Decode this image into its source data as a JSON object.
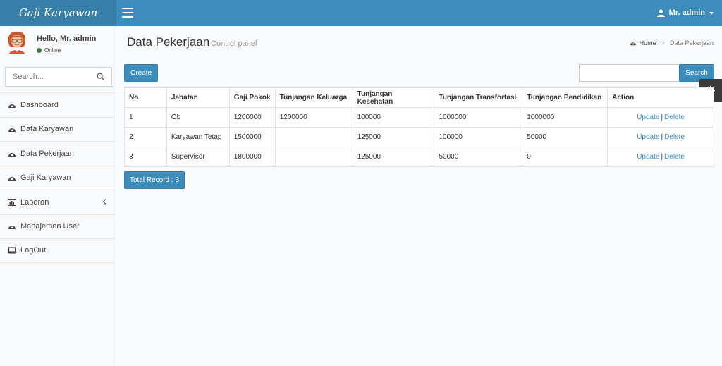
{
  "app": {
    "logo_text": "Gaji Karyawan"
  },
  "header": {
    "user_label": "Mr. admin"
  },
  "sidebar": {
    "greeting": "Hello, Mr. admin",
    "status": "Online",
    "search_placeholder": "Search...",
    "items": [
      {
        "label": "Dashboard",
        "icon": "dashboard-icon"
      },
      {
        "label": "Data Karyawan",
        "icon": "dashboard-icon"
      },
      {
        "label": "Data Pekerjaan",
        "icon": "dashboard-icon"
      },
      {
        "label": "Gaji Karyawan",
        "icon": "dashboard-icon"
      },
      {
        "label": "Laporan",
        "icon": "bar-chart-icon"
      },
      {
        "label": "Manajemen User",
        "icon": "dashboard-icon"
      },
      {
        "label": "LogOut",
        "icon": "laptop-icon"
      }
    ]
  },
  "page": {
    "title": "Data Pekerjaan",
    "subtitle": "Control panel",
    "breadcrumb": {
      "home": "Home",
      "current": "Data Pekerjaan"
    }
  },
  "toolbar": {
    "create_label": "Create",
    "search_label": "Search"
  },
  "table": {
    "headers": [
      "No",
      "Jabatan",
      "Gaji Pokok",
      "Tunjangan Keluarga",
      "Tunjangan Kesehatan",
      "Tunjangan Transfortasi",
      "Tunjangan Pendidikan",
      "Action"
    ],
    "rows": [
      {
        "no": "1",
        "jabatan": "Ob",
        "gaji_pokok": "1200000",
        "keluarga": "1200000",
        "kesehatan": "100000",
        "transfortasi": "1000000",
        "pendidikan": "1000000"
      },
      {
        "no": "2",
        "jabatan": "Karyawan Tetap",
        "gaji_pokok": "1500000",
        "keluarga": "",
        "kesehatan": "125000",
        "transfortasi": "100000",
        "pendidikan": "50000"
      },
      {
        "no": "3",
        "jabatan": "Supervisor",
        "gaji_pokok": "1800000",
        "keluarga": "",
        "kesehatan": "125000",
        "transfortasi": "50000",
        "pendidikan": "0"
      }
    ],
    "action_update": "Update",
    "action_sep": "|",
    "action_delete": "Delete"
  },
  "footer": {
    "total_label": "Total Record : 3"
  },
  "colors": {
    "primary": "#3c8dbc",
    "logo_bg": "#367fa9",
    "online": "#3c763d"
  }
}
